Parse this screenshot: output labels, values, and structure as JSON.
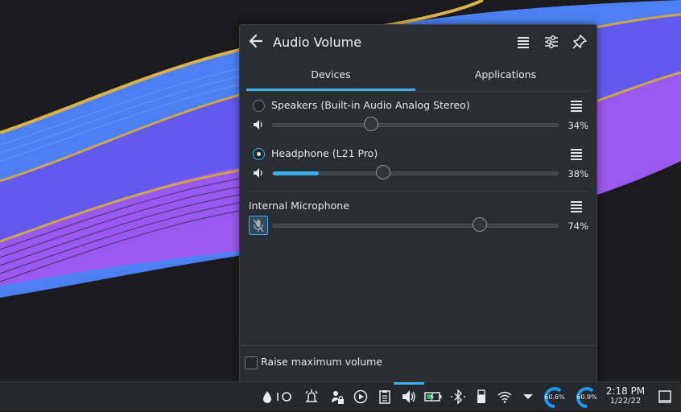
{
  "popup": {
    "title": "Audio Volume",
    "tabs": [
      "Devices",
      "Applications"
    ],
    "active_tab": "Devices",
    "devices": [
      {
        "name": "Speakers (Built-in Audio Analog Stereo)",
        "selected": false,
        "volume": 34,
        "volume_label": "34%",
        "level": 0
      },
      {
        "name": "Headphone (L21 Pro)",
        "selected": true,
        "volume": 38,
        "volume_label": "38%",
        "level": 16
      }
    ],
    "input": {
      "name": "Internal Microphone",
      "muted": true,
      "volume": 74,
      "volume_label": "74%"
    },
    "footer": {
      "raise_max_label": "Raise maximum volume",
      "checked": false
    }
  },
  "taskbar": {
    "gauge1": "60.6%",
    "gauge2": "60.9%",
    "time": "2:18 PM",
    "date": "1/22/22"
  },
  "icons": [
    "back-arrow-icon",
    "menu-icon",
    "mixer-icon",
    "pin-icon",
    "speaker-icon",
    "mic-muted-icon",
    "raindrop-icon",
    "toggle-icon",
    "alarm-icon",
    "lock-icon",
    "play-icon",
    "clipboard-icon",
    "volume-icon",
    "battery-icon",
    "bluetooth-icon",
    "usb-icon",
    "wifi-icon",
    "chevron-up-icon",
    "show-desktop-icon"
  ],
  "colors": {
    "accent": "#3daee9",
    "panel": "#2a2e32",
    "taskbar": "#25282c"
  }
}
